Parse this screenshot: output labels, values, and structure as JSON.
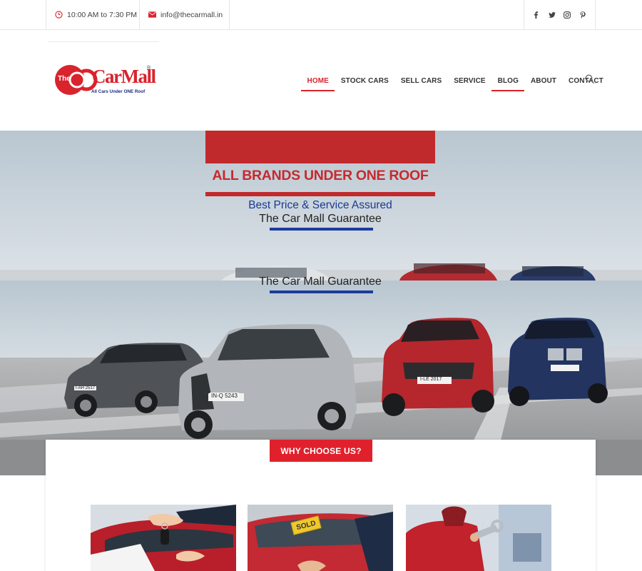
{
  "topbar": {
    "hours": "10:00 AM to 7:30 PM",
    "email": "info@thecarmall.in",
    "icons": [
      "clock-icon",
      "mail-icon"
    ],
    "social": [
      {
        "name": "facebook-icon",
        "glyph": "f"
      },
      {
        "name": "twitter-icon",
        "glyph": "t"
      },
      {
        "name": "instagram-icon",
        "glyph": "ig"
      },
      {
        "name": "pinterest-icon",
        "glyph": "p"
      }
    ]
  },
  "logo": {
    "prefix": "The",
    "brand": "CarMall",
    "registered": "®",
    "tagline": "All Cars Under ONE Roof"
  },
  "nav": {
    "items": [
      {
        "label": "HOME"
      },
      {
        "label": "STOCK CARS"
      },
      {
        "label": "SELL CARS"
      },
      {
        "label": "SERVICE"
      },
      {
        "label": "BLOG"
      },
      {
        "label": "ABOUT"
      },
      {
        "label": "CONTACT"
      }
    ],
    "active": "HOME",
    "search_icon": "search-icon"
  },
  "hero": {
    "title": "ALL BRANDS UNDER ONE ROOF",
    "subtitle1": "Best Price & Service Assured",
    "subtitle2": "The Car Mall Guarantee",
    "plates": [
      "I-AH 2517",
      "IN-Q 5243",
      "I-LE 2017"
    ]
  },
  "why": {
    "heading": "WHY CHOOSE US?",
    "card2_sign": "SOLD"
  },
  "colors": {
    "accent": "#d9232d",
    "banner_red": "#c12a2d",
    "banner_blue": "#1b3c9a"
  }
}
